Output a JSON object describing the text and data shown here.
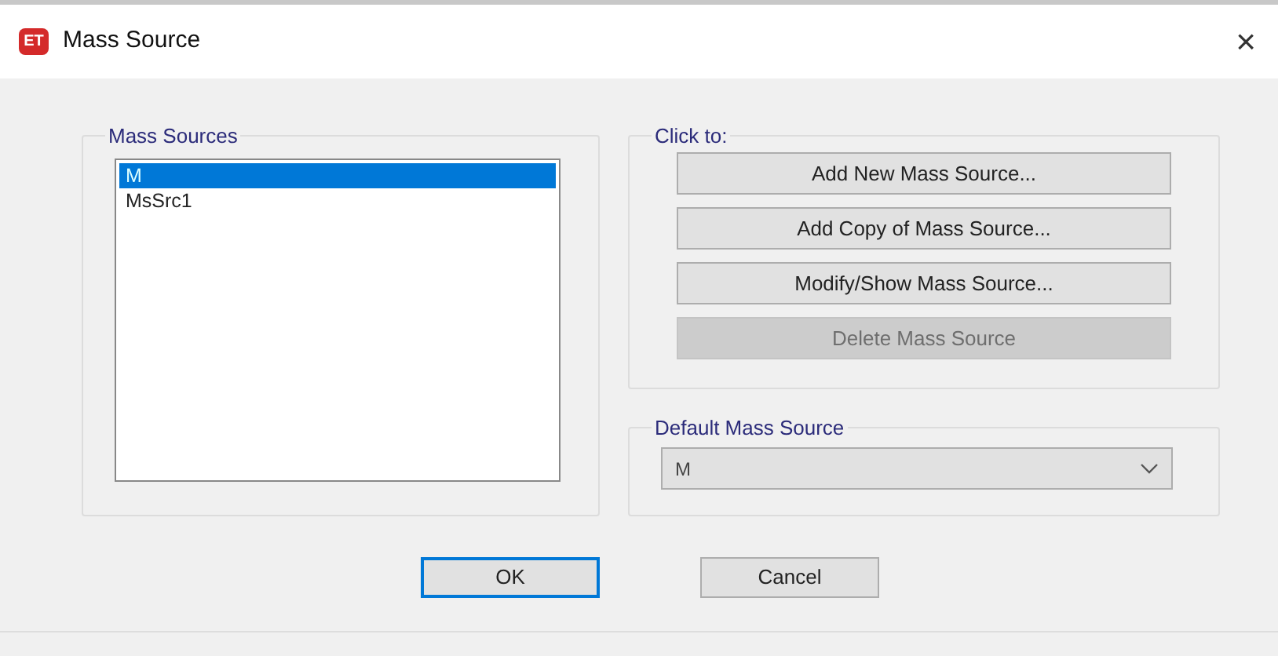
{
  "window": {
    "icon_text": "ET",
    "title": "Mass Source",
    "close": "×"
  },
  "mass_sources": {
    "label": "Mass Sources",
    "items": [
      {
        "label": "M",
        "selected": true
      },
      {
        "label": "MsSrc1",
        "selected": false
      }
    ]
  },
  "click_to": {
    "label": "Click to:",
    "buttons": [
      {
        "label": "Add New Mass Source...",
        "disabled": false
      },
      {
        "label": "Add Copy of Mass Source...",
        "disabled": false
      },
      {
        "label": "Modify/Show Mass Source...",
        "disabled": false
      },
      {
        "label": "Delete Mass Source",
        "disabled": true
      }
    ]
  },
  "default_mass_source": {
    "label": "Default Mass Source",
    "value": "M"
  },
  "buttons": [
    {
      "label": "OK",
      "default": true
    },
    {
      "label": "Cancel",
      "default": false
    }
  ]
}
